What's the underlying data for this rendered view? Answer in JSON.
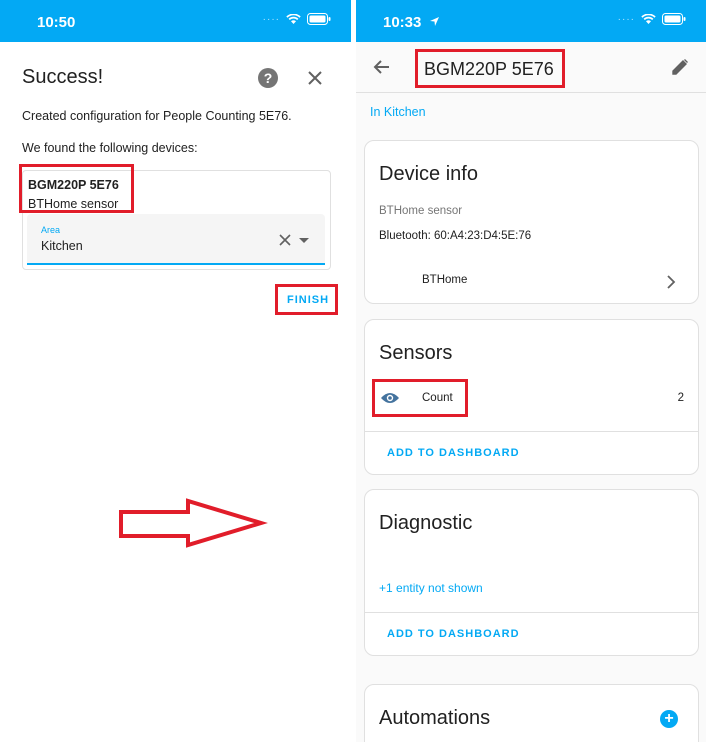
{
  "left": {
    "status": {
      "time": "10:50"
    },
    "dialog": {
      "title": "Success!",
      "help_glyph": "?",
      "message": "Created configuration for People Counting 5E76.",
      "found_text": "We found the following devices:",
      "device": {
        "name": "BGM220P 5E76",
        "type": "BTHome sensor"
      },
      "area": {
        "label": "Area",
        "value": "Kitchen"
      },
      "finish_label": "FINISH"
    }
  },
  "right": {
    "status": {
      "time": "10:33"
    },
    "title": "BGM220P 5E76",
    "area_link": "In Kitchen",
    "device_info": {
      "title": "Device info",
      "type": "BTHome sensor",
      "bluetooth": "Bluetooth: 60:A4:23:D4:5E:76",
      "integration": "BTHome"
    },
    "sensors": {
      "title": "Sensors",
      "entity_name": "Count",
      "entity_value": "2",
      "add_label": "ADD TO DASHBOARD"
    },
    "diagnostic": {
      "title": "Diagnostic",
      "hidden_text": "+1 entity not shown",
      "add_label": "ADD TO DASHBOARD"
    },
    "automations": {
      "title": "Automations",
      "add_glyph": "+"
    }
  },
  "colors": {
    "accent": "#03a9f4",
    "highlight": "#e11d2a"
  }
}
